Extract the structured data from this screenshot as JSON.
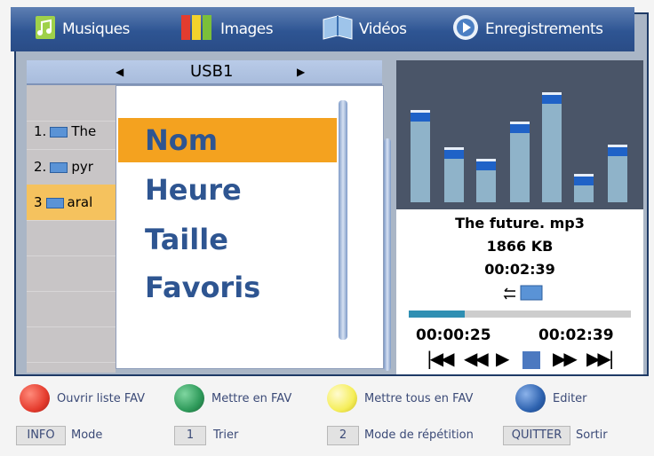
{
  "tabs": [
    {
      "label": "Musiques",
      "icon": "music-note-icon"
    },
    {
      "label": "Images",
      "icon": "image-strips-icon"
    },
    {
      "label": "Vidéos",
      "icon": "video-book-icon"
    },
    {
      "label": "Enregistrements",
      "icon": "record-reel-icon"
    }
  ],
  "source": {
    "label": "USB1"
  },
  "files": [
    {
      "label": "1.",
      "name": "The"
    },
    {
      "label": "2.",
      "name": "pyr"
    },
    {
      "label": "3",
      "name": "aral"
    }
  ],
  "sort_menu": {
    "items": [
      "Nom",
      "Heure",
      "Taille",
      "Favoris"
    ],
    "selected": "Nom"
  },
  "equalizer": {
    "levels": [
      0.78,
      0.45,
      0.35,
      0.68,
      0.93,
      0.22,
      0.48
    ]
  },
  "now_playing": {
    "title": "The future. mp3",
    "size": "1866 KB",
    "duration": "00:02:39",
    "elapsed": "00:00:25",
    "total": "00:02:39",
    "progress": 0.25
  },
  "color_legend": [
    {
      "label": "Ouvrir liste FAV",
      "color": "#e53c2e"
    },
    {
      "label": "Mettre en FAV",
      "color": "#2e9a5a"
    },
    {
      "label": "Mettre tous en FAV",
      "color": "#f5ee5a"
    },
    {
      "label": "Editer",
      "color": "#2e63b0"
    }
  ],
  "key_legend": [
    {
      "key": "INFO",
      "label": "Mode"
    },
    {
      "key": "1",
      "label": "Trier"
    },
    {
      "key": "2",
      "label": "Mode de répétition"
    },
    {
      "key": "QUITTER",
      "label": "Sortir"
    }
  ]
}
